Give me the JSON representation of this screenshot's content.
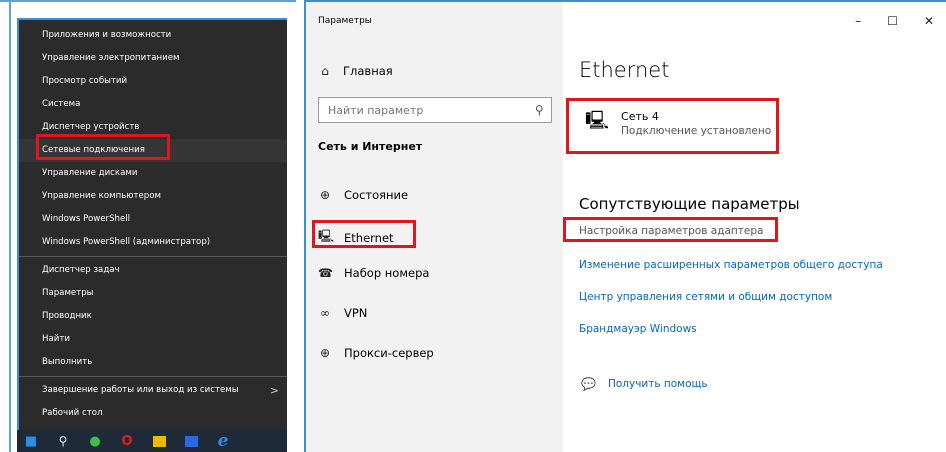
{
  "winx_menu": {
    "groups": [
      [
        "Приложения и возможности",
        "Управление электропитанием",
        "Просмотр событий",
        "Система",
        "Диспетчер устройств",
        "Сетевые подключения",
        "Управление дисками",
        "Управление компьютером",
        "Windows PowerShell",
        "Windows PowerShell (администратор)"
      ],
      [
        "Диспетчер задач",
        "Параметры",
        "Проводник",
        "Найти",
        "Выполнить"
      ],
      [
        "Завершение работы или выход из системы",
        "Рабочий стол"
      ]
    ],
    "highlighted": "Сетевые подключения",
    "submenu_arrow": ">"
  },
  "taskbar": {
    "icons": [
      "windows-start-icon",
      "search-icon",
      "app-green-icon",
      "opera-icon",
      "folder-icon",
      "store-icon",
      "edge-icon"
    ]
  },
  "settings": {
    "window_title": "Параметры",
    "controls": {
      "minimize": "–",
      "maximize": "☐",
      "close": "✕"
    },
    "home_label": "Главная",
    "search_placeholder": "Найти параметр",
    "section_title": "Сеть и Интернет",
    "nav_items": [
      {
        "label": "Состояние",
        "icon": "globe-icon"
      },
      {
        "label": "Ethernet",
        "icon": "ethernet-icon"
      },
      {
        "label": "Набор номера",
        "icon": "dialup-icon"
      },
      {
        "label": "VPN",
        "icon": "vpn-icon"
      },
      {
        "label": "Прокси-сервер",
        "icon": "proxy-globe-icon"
      }
    ],
    "page_title": "Ethernet",
    "connection": {
      "name": "Сеть 4",
      "status": "Подключение установлено"
    },
    "related_title": "Сопутствующие параметры",
    "links": [
      "Настройка параметров адаптера",
      "Изменение расширенных параметров общего доступа",
      "Центр управления сетями и общим доступом",
      "Брандмауэр Windows"
    ],
    "help_label": "Получить помощь"
  },
  "colors": {
    "highlight_box": "#e0161f",
    "link_blue": "#0067c0",
    "menu_bg": "#2b2b2b"
  }
}
